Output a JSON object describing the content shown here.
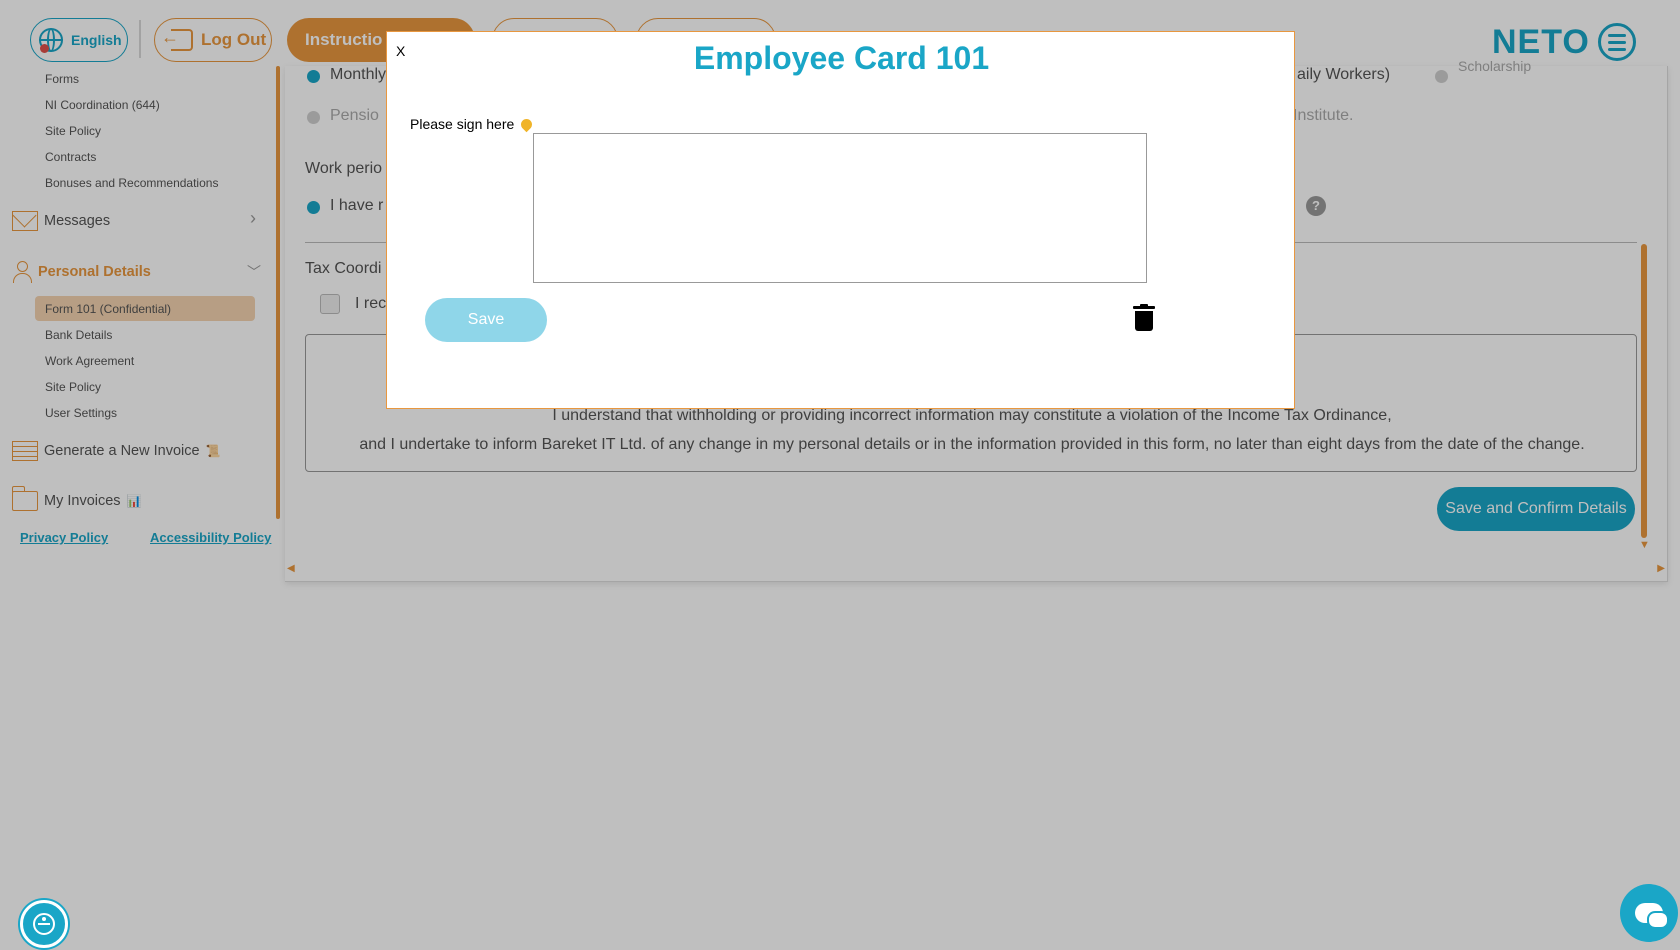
{
  "header": {
    "language_label": "English",
    "logout_label": "Log Out",
    "tab_instructions": "Instructio",
    "logo_text": "NETO"
  },
  "sidebar": {
    "sub_items_top": [
      "Forms",
      "NI Coordination (644)",
      "Site Policy",
      "Contracts",
      "Bonuses and Recommendations"
    ],
    "messages_label": "Messages",
    "personal_details_label": "Personal Details",
    "sub_items_personal": [
      "Form 101 (Confidential)",
      "Bank Details",
      "Work Agreement",
      "Site Policy",
      "User Settings"
    ],
    "generate_invoice_label": "Generate a New Invoice",
    "generate_invoice_emoji": "📜",
    "my_invoices_label": "My Invoices",
    "my_invoices_emoji": "📊",
    "privacy_policy": "Privacy Policy",
    "accessibility_policy": "Accessibility Policy"
  },
  "main": {
    "monthly_fragment": "Monthly",
    "daily_workers_fragment": "aily Workers)",
    "scholarship_fragment": "Scholarship",
    "pension_fragment": "Pensio",
    "institute_fragment": "Institute.",
    "work_period_fragment": "Work perio",
    "i_have_fragment": "I have r",
    "help_symbol": "?",
    "tax_coord_fragment": "Tax Coordi",
    "i_rec_fragment": "I rec",
    "declaration_line_1": "I understand that withholding or providing incorrect information may constitute a violation of the Income Tax Ordinance,",
    "declaration_line_2": "and I undertake to inform Bareket IT Ltd. of any change in my personal details or in the information provided in this form, no later than eight days from the date of the change.",
    "confirm_button": "Save and Confirm Details"
  },
  "modal": {
    "close_label": "X",
    "title": "Employee Card 101",
    "sign_label": "Please sign here",
    "save_label": "Save"
  },
  "colors": {
    "accent_blue": "#1aa6c7",
    "accent_orange": "#e8973f",
    "save_disabled": "#8fd6e9"
  }
}
